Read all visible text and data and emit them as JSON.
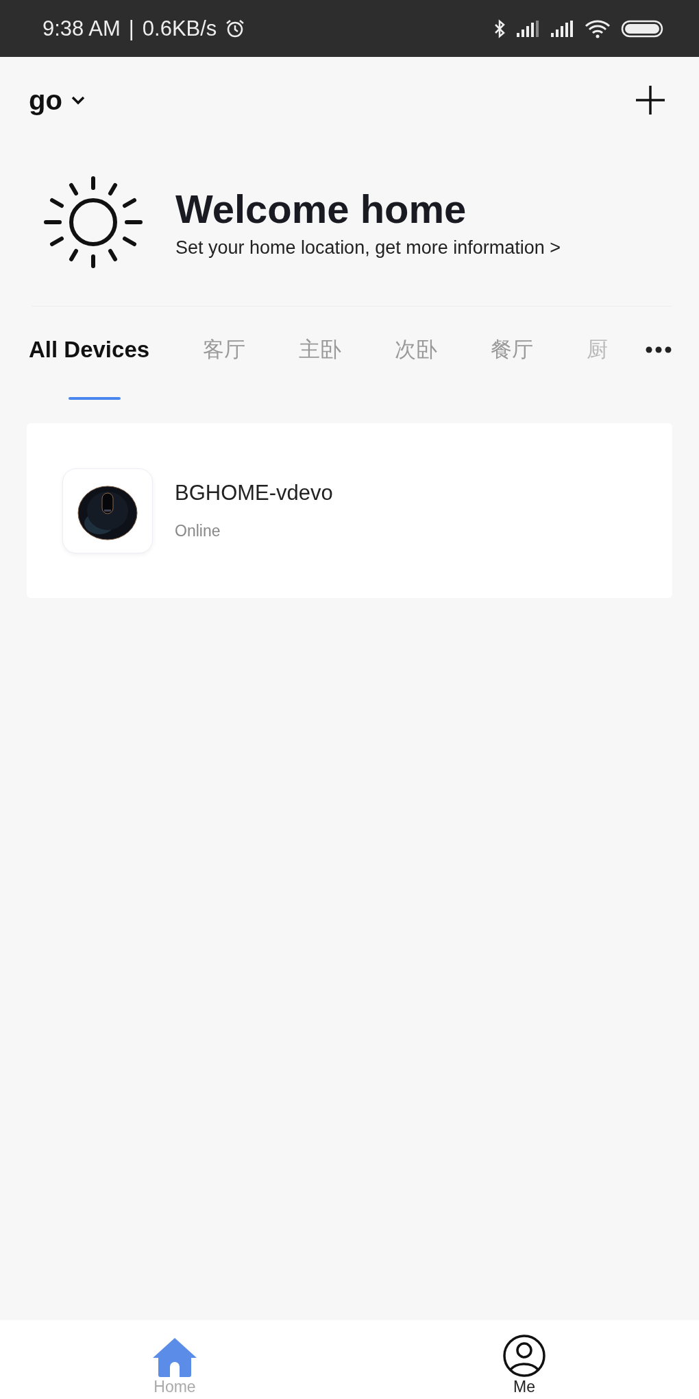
{
  "status_bar": {
    "time": "9:38  AM",
    "separator": "|",
    "speed": "0.6KB/s"
  },
  "header": {
    "home_name": "go"
  },
  "welcome": {
    "title": "Welcome home",
    "subtitle": "Set your home location, get more information",
    "chevron": ">"
  },
  "tabs": [
    {
      "label": "All Devices",
      "selected": true
    },
    {
      "label": "客厅",
      "selected": false
    },
    {
      "label": "主卧",
      "selected": false
    },
    {
      "label": "次卧",
      "selected": false
    },
    {
      "label": "餐厅",
      "selected": false
    },
    {
      "label": "厨",
      "selected": false,
      "faded": true
    }
  ],
  "devices": [
    {
      "name": "BGHOME-vdevo",
      "status": "Online"
    }
  ],
  "bottom_nav": [
    {
      "label": "Home",
      "kind": "home",
      "selected": true
    },
    {
      "label": "Me",
      "kind": "me",
      "selected": false
    }
  ]
}
